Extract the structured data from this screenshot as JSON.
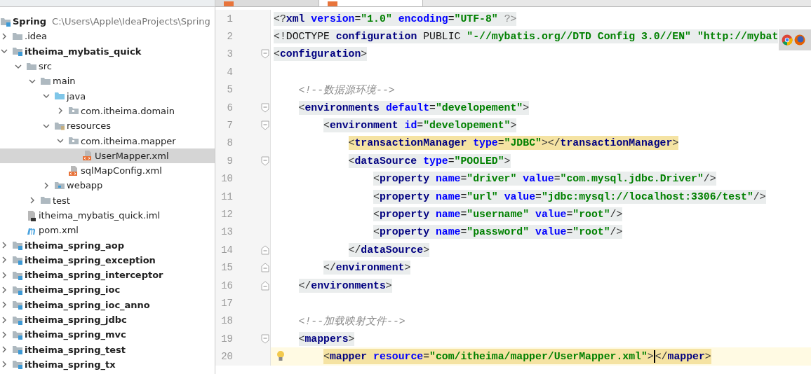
{
  "project_tree": [
    {
      "label": "Spring",
      "kind": "module",
      "path": "C:\\Users\\Apple\\IdeaProjects\\Spring",
      "selected": false,
      "children": [
        {
          "label": ".idea",
          "kind": "folder",
          "expanded": false,
          "selected": false
        },
        {
          "label": "itheima_mybatis_quick",
          "kind": "module",
          "expanded": true,
          "selected": false,
          "children": [
            {
              "label": "src",
              "kind": "folder",
              "expanded": true,
              "selected": false,
              "children": [
                {
                  "label": "main",
                  "kind": "folder",
                  "expanded": true,
                  "selected": false,
                  "children": [
                    {
                      "label": "java",
                      "kind": "source",
                      "expanded": true,
                      "selected": false,
                      "children": [
                        {
                          "label": "com.itheima.domain",
                          "kind": "package",
                          "expanded": false,
                          "selected": false
                        }
                      ]
                    },
                    {
                      "label": "resources",
                      "kind": "resources",
                      "expanded": true,
                      "selected": false,
                      "children": [
                        {
                          "label": "com.itheima.mapper",
                          "kind": "package",
                          "expanded": true,
                          "selected": false,
                          "children": [
                            {
                              "label": "UserMapper.xml",
                              "kind": "xml",
                              "selected": true
                            }
                          ]
                        },
                        {
                          "label": "sqlMapConfig.xml",
                          "kind": "xml",
                          "selected": false
                        }
                      ]
                    },
                    {
                      "label": "webapp",
                      "kind": "web",
                      "expanded": false,
                      "selected": false
                    }
                  ]
                },
                {
                  "label": "test",
                  "kind": "folder",
                  "expanded": false,
                  "selected": false
                }
              ]
            },
            {
              "label": "itheima_mybatis_quick.iml",
              "kind": "iml",
              "selected": false
            },
            {
              "label": "pom.xml",
              "kind": "maven",
              "selected": false
            }
          ]
        },
        {
          "label": "itheima_spring_aop",
          "kind": "module",
          "expanded": false,
          "selected": false
        },
        {
          "label": "itheima_spring_exception",
          "kind": "module",
          "expanded": false,
          "selected": false
        },
        {
          "label": "itheima_spring_interceptor",
          "kind": "module",
          "expanded": false,
          "selected": false
        },
        {
          "label": "itheima_spring_ioc",
          "kind": "module",
          "expanded": false,
          "selected": false
        },
        {
          "label": "itheima_spring_ioc_anno",
          "kind": "module",
          "expanded": false,
          "selected": false
        },
        {
          "label": "itheima_spring_jdbc",
          "kind": "module",
          "expanded": false,
          "selected": false
        },
        {
          "label": "itheima_spring_mvc",
          "kind": "module",
          "expanded": false,
          "selected": false
        },
        {
          "label": "itheima_spring_test",
          "kind": "module",
          "expanded": false,
          "selected": false
        },
        {
          "label": "itheima_spring_tx",
          "kind": "module",
          "expanded": false,
          "selected": false
        }
      ]
    }
  ],
  "editor_tabs": [
    {
      "selected": false
    },
    {
      "selected": true
    }
  ],
  "code_lines": [
    {
      "number": "1",
      "fold_start": false,
      "fold_end": false,
      "matched": false,
      "current": false,
      "intention": false,
      "text": "<?xml version=\"1.0\" encoding=\"UTF-8\" ?>"
    },
    {
      "number": "2",
      "fold_start": false,
      "fold_end": false,
      "matched": false,
      "current": false,
      "intention": false,
      "text": "<!DOCTYPE configuration PUBLIC \"-//mybatis.org//DTD Config 3.0//EN\" \"http://mybat"
    },
    {
      "number": "3",
      "fold_start": true,
      "fold_end": false,
      "matched": false,
      "current": false,
      "intention": false,
      "text": "<configuration>"
    },
    {
      "number": "4",
      "fold_start": false,
      "fold_end": false,
      "current": false,
      "intention": false
    },
    {
      "number": "5",
      "fold_start": false,
      "fold_end": false,
      "matched": false,
      "current": false,
      "intention": false,
      "text": "    <!--数据源环境-->"
    },
    {
      "number": "6",
      "fold_start": true,
      "fold_end": false,
      "matched": false,
      "current": false,
      "intention": false,
      "text": "    <environments default=\"developement\">"
    },
    {
      "number": "7",
      "fold_start": true,
      "fold_end": false,
      "matched": false,
      "current": false,
      "intention": false,
      "text": "        <environment id=\"developement\">"
    },
    {
      "number": "8",
      "fold_start": false,
      "fold_end": false,
      "matched": true,
      "current": false,
      "intention": false,
      "text": "            <transactionManager type=\"JDBC\"></transactionManager>"
    },
    {
      "number": "9",
      "fold_start": true,
      "fold_end": false,
      "matched": false,
      "current": false,
      "intention": false,
      "text": "            <dataSource type=\"POOLED\">"
    },
    {
      "number": "10",
      "fold_start": false,
      "fold_end": false,
      "matched": false,
      "current": false,
      "intention": false,
      "text": "                <property name=\"driver\" value=\"com.mysql.jdbc.Driver\"/>"
    },
    {
      "number": "11",
      "fold_start": false,
      "fold_end": false,
      "matched": false,
      "current": false,
      "intention": false,
      "text": "                <property name=\"url\" value=\"jdbc:mysql://localhost:3306/test\"/>"
    },
    {
      "number": "12",
      "fold_start": false,
      "fold_end": false,
      "matched": false,
      "current": false,
      "intention": false,
      "text": "                <property name=\"username\" value=\"root\"/>"
    },
    {
      "number": "13",
      "fold_start": false,
      "fold_end": false,
      "matched": false,
      "current": false,
      "intention": false,
      "text": "                <property name=\"password\" value=\"root\"/>"
    },
    {
      "number": "14",
      "fold_start": false,
      "fold_end": true,
      "matched": false,
      "current": false,
      "intention": false,
      "text": "            </dataSource>"
    },
    {
      "number": "15",
      "fold_start": false,
      "fold_end": true,
      "matched": false,
      "current": false,
      "intention": false,
      "text": "        </environment>"
    },
    {
      "number": "16",
      "fold_start": false,
      "fold_end": true,
      "matched": false,
      "current": false,
      "intention": false,
      "text": "    </environments>"
    },
    {
      "number": "17",
      "fold_start": false,
      "fold_end": false,
      "current": false,
      "intention": false
    },
    {
      "number": "18",
      "fold_start": false,
      "fold_end": false,
      "matched": false,
      "current": false,
      "intention": false,
      "text": "    <!--加载映射文件-->"
    },
    {
      "number": "19",
      "fold_start": true,
      "fold_end": false,
      "matched": false,
      "current": false,
      "intention": false,
      "text": "    <mappers>"
    },
    {
      "number": "20",
      "fold_start": false,
      "fold_end": false,
      "matched": true,
      "current": true,
      "intention": true,
      "text": "        <mapper resource=\"com/itheima/mapper/UserMapper.xml\">",
      "after_caret": "</mapper>"
    }
  ]
}
